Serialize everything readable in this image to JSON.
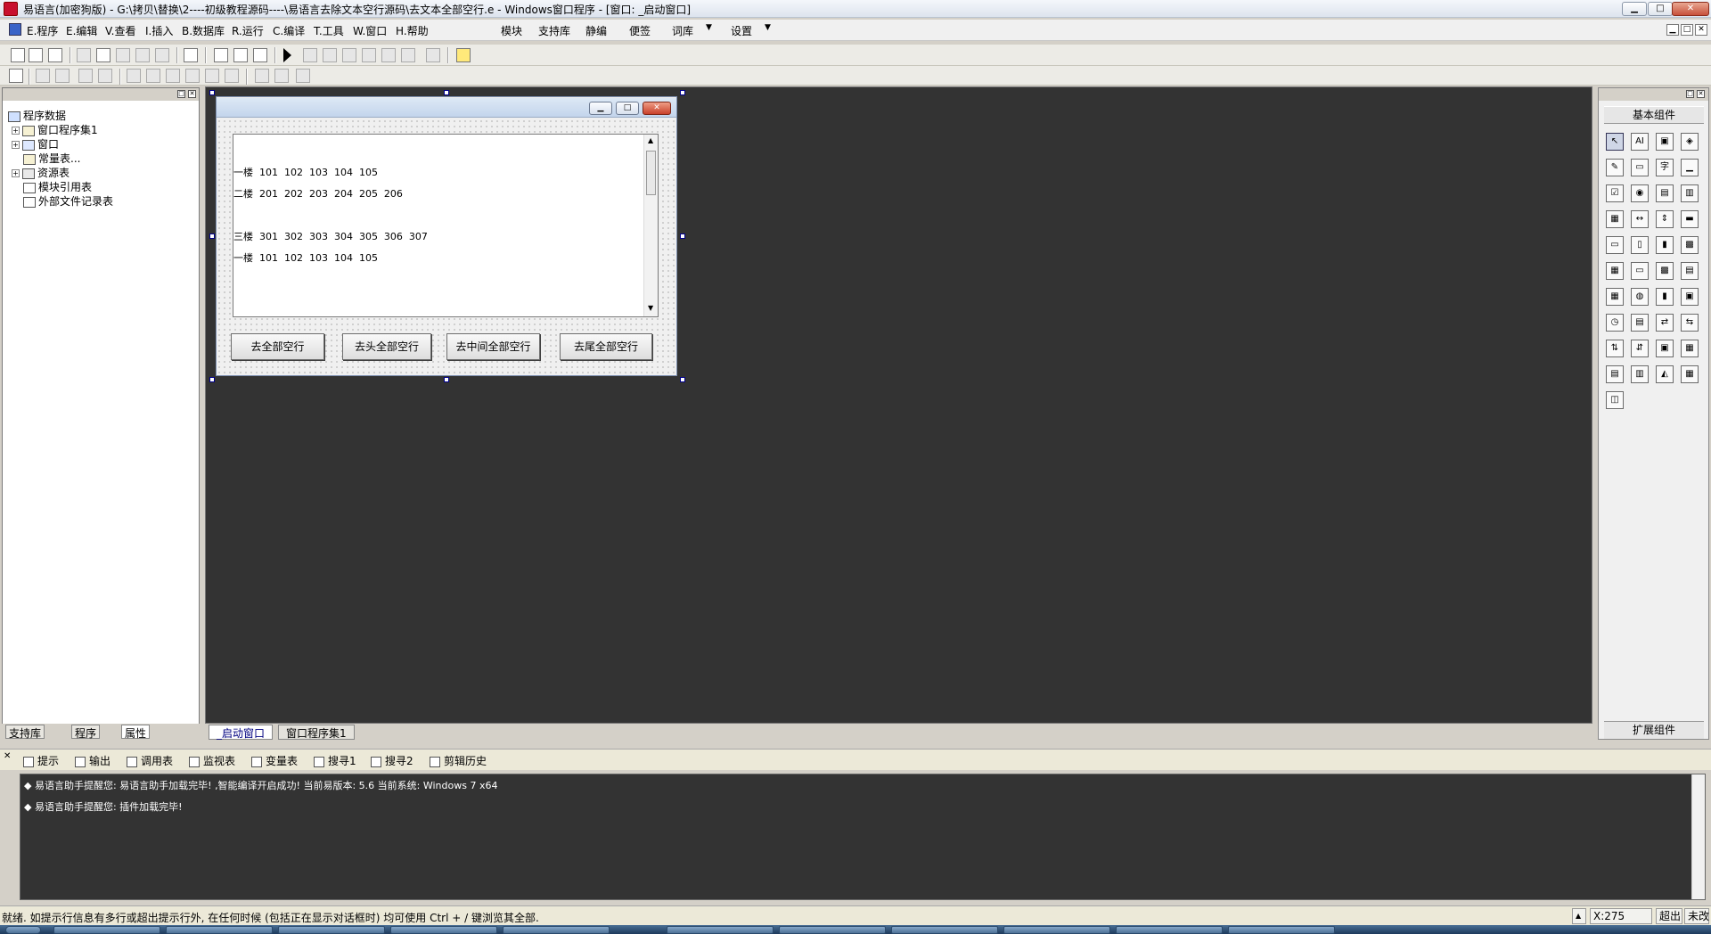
{
  "window": {
    "title": "易语言(加密狗版) - G:\\拷贝\\替换\\2----初级教程源码----\\易语言去除文本空行源码\\去文本全部空行.e - Windows窗口程序 - [窗口: _启动窗口]",
    "min": "▁",
    "max": "□",
    "close": "✕"
  },
  "menu": {
    "items": [
      "E.程序",
      "E.编辑",
      "V.查看",
      "I.插入",
      "B.数据库",
      "R.运行",
      "C.编译",
      "T.工具",
      "W.窗口",
      "H.帮助"
    ],
    "extras": [
      "模块",
      "支持库",
      "静编",
      "便签",
      "词库",
      "设置"
    ],
    "dropdown_arrow": "▼"
  },
  "left_panel": {
    "tree": [
      {
        "label": "程序数据",
        "expander": ""
      },
      {
        "label": "窗口程序集1",
        "expander": "+"
      },
      {
        "label": "窗口",
        "expander": "+"
      },
      {
        "label": "常量表...",
        "expander": ""
      },
      {
        "label": "资源表",
        "expander": "+"
      },
      {
        "label": "模块引用表",
        "expander": ""
      },
      {
        "label": "外部文件记录表",
        "expander": ""
      }
    ],
    "tabs": [
      "支持库",
      "程序",
      "属性"
    ]
  },
  "form": {
    "lines": [
      "一楼  101  102  103  104  105",
      "二楼  201  202  203  204  205  206",
      "",
      "三楼  301  302  303  304  305  306  307",
      "一楼  101  102  103  104  105"
    ],
    "buttons": [
      "去全部空行",
      "去头全部空行",
      "去中间全部空行",
      "去尾全部空行"
    ],
    "ctrl_min": "▁",
    "ctrl_max": "□",
    "ctrl_close": "✕"
  },
  "main_tabs": [
    "_启动窗口",
    "窗口程序集1"
  ],
  "right_panel": {
    "header": "基本组件",
    "footer": "扩展组件",
    "icons": [
      "↖",
      "AI",
      "▣",
      "◈",
      "✎",
      "▭",
      "字",
      "▁",
      "☑",
      "◉",
      "▤",
      "▥",
      "▦",
      "↔",
      "⇕",
      "▬",
      "▭",
      "▯",
      "▮",
      "▩",
      "▦",
      "▭",
      "▩",
      "▤",
      "▦",
      "◍",
      "▮",
      "▣",
      "◷",
      "▤",
      "⇄",
      "⇆",
      "⇅",
      "⇵",
      "▣",
      "▦",
      "▤",
      "▥",
      "◭",
      "▦",
      "◫"
    ]
  },
  "output_tabs": [
    "提示",
    "输出",
    "调用表",
    "监视表",
    "变量表",
    "搜寻1",
    "搜寻2",
    "剪辑历史"
  ],
  "output_lines": [
    "◆ 易语言助手提醒您: 易语言助手加载完毕!  ,智能编译开启成功!  当前易版本: 5.6  当前系统: Windows 7 x64",
    "◆ 易语言助手提醒您: 插件加载完毕!"
  ],
  "status": {
    "text": "就绪. 如提示行信息有多行或超出提示行外, 在任何时候 (包括正在显示对话框时) 均可使用 Ctrl + / 键浏览其全部.",
    "coord": "X:275",
    "mode1": "超出",
    "mode2": "未改"
  }
}
